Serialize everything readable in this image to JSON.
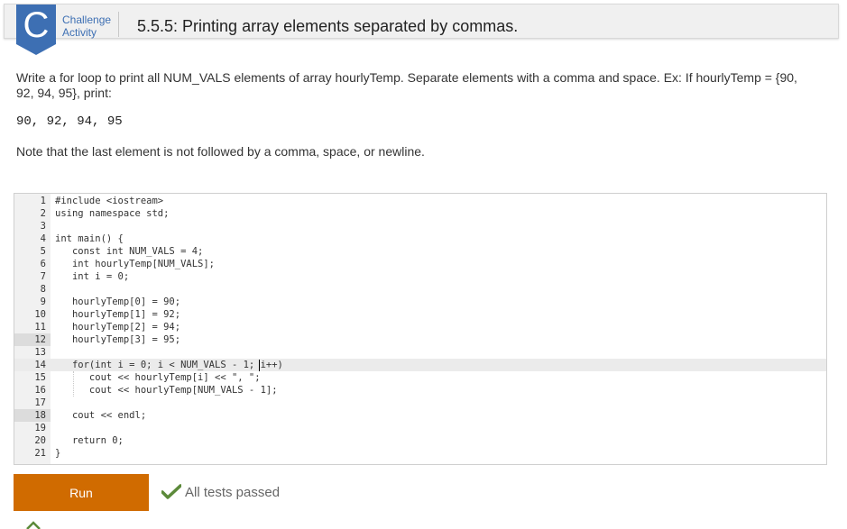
{
  "header": {
    "badge_letter": "C",
    "activity_type_line1": "Challenge",
    "activity_type_line2": "Activity",
    "title": "5.5.5: Printing array elements separated by commas."
  },
  "prompt": {
    "instructions": "Write a for loop to print all NUM_VALS elements of array hourlyTemp. Separate elements with a comma and space. Ex: If hourlyTemp = {90, 92, 94, 95}, print:",
    "example_output": "90, 92, 94, 95",
    "note": "Note that the last element is not followed by a comma, space, or newline."
  },
  "editor": {
    "lines": [
      {
        "num": "1",
        "code": "#include <iostream>"
      },
      {
        "num": "2",
        "code": "using namespace std;"
      },
      {
        "num": "3",
        "code": ""
      },
      {
        "num": "4",
        "code": "int main() {"
      },
      {
        "num": "5",
        "code": "   const int NUM_VALS = 4;"
      },
      {
        "num": "6",
        "code": "   int hourlyTemp[NUM_VALS];"
      },
      {
        "num": "7",
        "code": "   int i = 0;"
      },
      {
        "num": "8",
        "code": ""
      },
      {
        "num": "9",
        "code": "   hourlyTemp[0] = 90;"
      },
      {
        "num": "10",
        "code": "   hourlyTemp[1] = 92;"
      },
      {
        "num": "11",
        "code": "   hourlyTemp[2] = 94;"
      },
      {
        "num": "12",
        "code": "   hourlyTemp[3] = 95;"
      },
      {
        "num": "13",
        "code": ""
      },
      {
        "num": "14",
        "code": "   for(int i = 0; i < NUM_VALS - 1; i++)"
      },
      {
        "num": "15",
        "code": "      cout << hourlyTemp[i] << \", \";"
      },
      {
        "num": "16",
        "code": "      cout << hourlyTemp[NUM_VALS - 1];"
      },
      {
        "num": "17",
        "code": ""
      },
      {
        "num": "18",
        "code": "   cout << endl;"
      },
      {
        "num": "19",
        "code": ""
      },
      {
        "num": "20",
        "code": "   return 0;"
      },
      {
        "num": "21",
        "code": "}"
      }
    ],
    "active_line": 14
  },
  "actions": {
    "run_label": "Run",
    "status_text": "All tests passed"
  },
  "colors": {
    "brand_blue": "#3d6fb3",
    "run_orange": "#d06b00",
    "check_green": "#5c8a3a"
  },
  "icons": {
    "status": "checkmark-icon",
    "footer": "chevron-up-icon"
  }
}
